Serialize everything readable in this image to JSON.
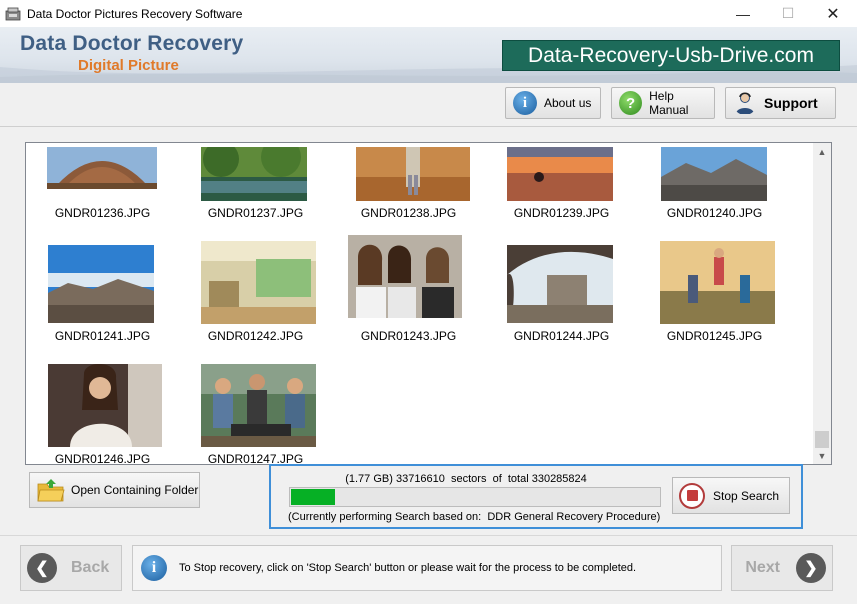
{
  "window": {
    "title": "Data Doctor Pictures Recovery Software",
    "minimize_glyph": "—",
    "maximize_glyph": "☐",
    "close_glyph": "✕"
  },
  "header": {
    "brand_line1": "Data Doctor Recovery",
    "brand_line2": "Digital Picture",
    "site": "Data-Recovery-Usb-Drive.com"
  },
  "toolbar": {
    "about_label": "About us",
    "help_label": "Help Manual",
    "support_label": "Support"
  },
  "gallery": {
    "items": [
      {
        "name": "GNDR01236.JPG",
        "icon": "photo-temple-thumbnail"
      },
      {
        "name": "GNDR01237.JPG",
        "icon": "photo-pond-trees-thumbnail"
      },
      {
        "name": "GNDR01238.JPG",
        "icon": "photo-autumn-forest-person-thumbnail"
      },
      {
        "name": "GNDR01239.JPG",
        "icon": "photo-sunset-desert-thumbnail"
      },
      {
        "name": "GNDR01240.JPG",
        "icon": "photo-mountain-valley-thumbnail"
      },
      {
        "name": "GNDR01241.JPG",
        "icon": "photo-mountain-sky-thumbnail"
      },
      {
        "name": "GNDR01242.JPG",
        "icon": "photo-cafe-interior-thumbnail"
      },
      {
        "name": "GNDR01243.JPG",
        "icon": "photo-three-girls-thumbnail"
      },
      {
        "name": "GNDR01244.JPG",
        "icon": "photo-cave-ruins-thumbnail"
      },
      {
        "name": "GNDR01245.JPG",
        "icon": "photo-friends-jumping-thumbnail"
      },
      {
        "name": "GNDR01246.JPG",
        "icon": "photo-woman-portrait-thumbnail"
      },
      {
        "name": "GNDR01247.JPG",
        "icon": "photo-group-barbecue-thumbnail"
      }
    ]
  },
  "actions": {
    "open_folder_label": "Open Containing Folder"
  },
  "progress": {
    "summary": "(1.77 GB) 33716610  sectors  of  total 330285824",
    "fraction": 0.102,
    "status": "(Currently performing Search based on:  DDR General Recovery Procedure)",
    "stop_label": "Stop Search",
    "fill_color": "#06b025"
  },
  "footer": {
    "back_label": "Back",
    "next_label": "Next",
    "info_text": "To Stop recovery, click on 'Stop Search' button or please wait for the process to be completed."
  }
}
